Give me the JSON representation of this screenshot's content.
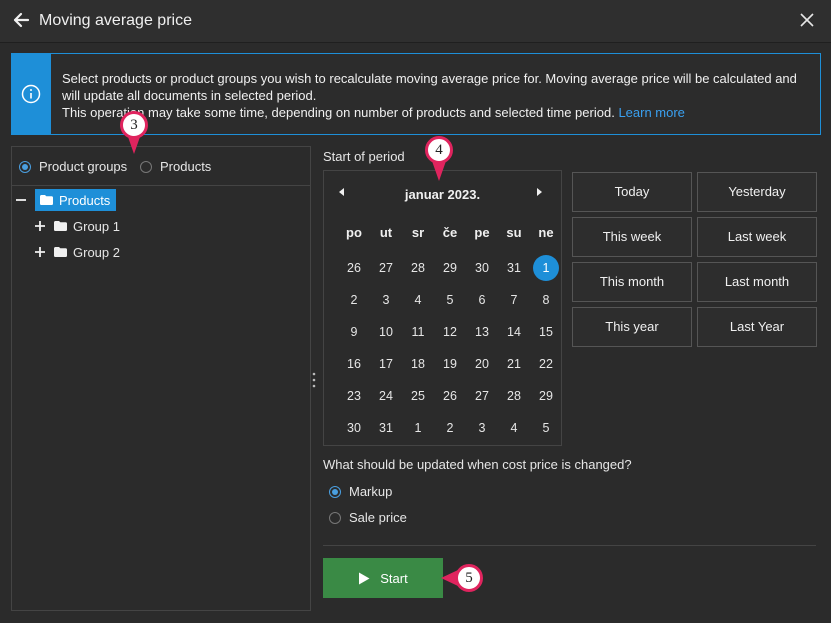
{
  "window": {
    "title": "Moving average price"
  },
  "info": {
    "line1": "Select products or product groups you wish to recalculate moving average price for. Moving average price will be calculated and",
    "line2": "will update all documents in selected period.",
    "line3": "This operation may take some time, depending on number of products and selected time period.",
    "learn_more": "Learn more"
  },
  "selection": {
    "options": [
      "Product groups",
      "Products"
    ],
    "selected": "Product groups"
  },
  "tree": {
    "root": "Products",
    "children": [
      "Group 1",
      "Group 2"
    ]
  },
  "period": {
    "label": "Start of period",
    "month_title": "januar 2023.",
    "weekdays": [
      "po",
      "ut",
      "sr",
      "če",
      "pe",
      "su",
      "ne"
    ],
    "weeks": [
      [
        "26",
        "27",
        "28",
        "29",
        "30",
        "31",
        "1"
      ],
      [
        "2",
        "3",
        "4",
        "5",
        "6",
        "7",
        "8"
      ],
      [
        "9",
        "10",
        "11",
        "12",
        "13",
        "14",
        "15"
      ],
      [
        "16",
        "17",
        "18",
        "19",
        "20",
        "21",
        "22"
      ],
      [
        "23",
        "24",
        "25",
        "26",
        "27",
        "28",
        "29"
      ],
      [
        "30",
        "31",
        "1",
        "2",
        "3",
        "4",
        "5"
      ]
    ],
    "selected_day": "1",
    "quick": {
      "today": "Today",
      "yesterday": "Yesterday",
      "this_week": "This week",
      "last_week": "Last week",
      "this_month": "This month",
      "last_month": "Last month",
      "this_year": "This year",
      "last_year": "Last Year"
    }
  },
  "update": {
    "question": "What should be updated when cost price is changed?",
    "options": [
      "Markup",
      "Sale price"
    ],
    "selected": "Markup"
  },
  "actions": {
    "start": "Start"
  },
  "callouts": {
    "c3": "3",
    "c4": "4",
    "c5": "5"
  },
  "colors": {
    "accent": "#1e8fd8",
    "start": "#3a8a45",
    "callout": "#e0245e"
  }
}
